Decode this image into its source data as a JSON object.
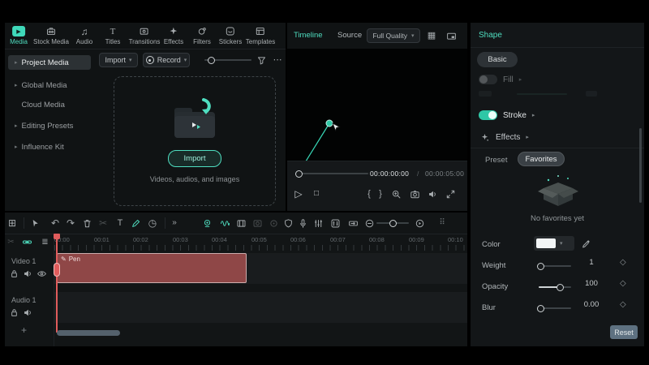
{
  "top_tabs": [
    {
      "label": "Media",
      "icon": "media-icon",
      "active": true
    },
    {
      "label": "Stock Media",
      "icon": "stock-media-icon"
    },
    {
      "label": "Audio",
      "icon": "audio-icon"
    },
    {
      "label": "Titles",
      "icon": "titles-icon"
    },
    {
      "label": "Transitions",
      "icon": "transitions-icon"
    },
    {
      "label": "Effects",
      "icon": "effects-icon"
    },
    {
      "label": "Filters",
      "icon": "filters-icon"
    },
    {
      "label": "Stickers",
      "icon": "stickers-icon"
    },
    {
      "label": "Templates",
      "icon": "templates-icon"
    }
  ],
  "media_panel": {
    "toolbar": {
      "import_label": "Import",
      "record_label": "Record"
    },
    "sidebar": [
      {
        "label": "Project Media",
        "active": true
      },
      {
        "label": "Global Media"
      },
      {
        "label": "Cloud Media"
      },
      {
        "label": "Editing Presets"
      },
      {
        "label": "Influence Kit"
      }
    ],
    "dropzone": {
      "import_label": "Import",
      "caption": "Videos, audios, and images"
    }
  },
  "preview": {
    "tabs": [
      {
        "label": "Timeline",
        "active": true
      },
      {
        "label": "Source"
      }
    ],
    "quality_selector": "Full Quality",
    "current_time": "00:00:00:00",
    "time_separator": "/",
    "duration": "00:00:05:00"
  },
  "inspector": {
    "title": "Shape",
    "basic_tab": "Basic",
    "fill_label": "Fill",
    "stroke_label": "Stroke",
    "effects_label": "Effects",
    "tabs": [
      {
        "label": "Preset"
      },
      {
        "label": "Favorites",
        "active": true
      }
    ],
    "empty_text": "No favorites yet",
    "properties": {
      "color_label": "Color",
      "weight_label": "Weight",
      "weight_value": "1",
      "opacity_label": "Opacity",
      "opacity_value": "100",
      "blur_label": "Blur",
      "blur_value": "0.00"
    },
    "reset_button": "Reset"
  },
  "timeline": {
    "ruler": [
      "00:00",
      "00:01",
      "00:02",
      "00:03",
      "00:04",
      "00:05",
      "00:06",
      "00:07",
      "00:08",
      "00:09",
      "00:10"
    ],
    "tracks": [
      {
        "name": "Video 1"
      },
      {
        "name": "Audio 1"
      }
    ],
    "clip_label": "Pen",
    "add_track_button": "+"
  },
  "colors": {
    "accent": "#4fdec0",
    "clip_fill": "#8f4747",
    "playhead": "#e05c5c",
    "canvas_line": "#38d9b8"
  }
}
